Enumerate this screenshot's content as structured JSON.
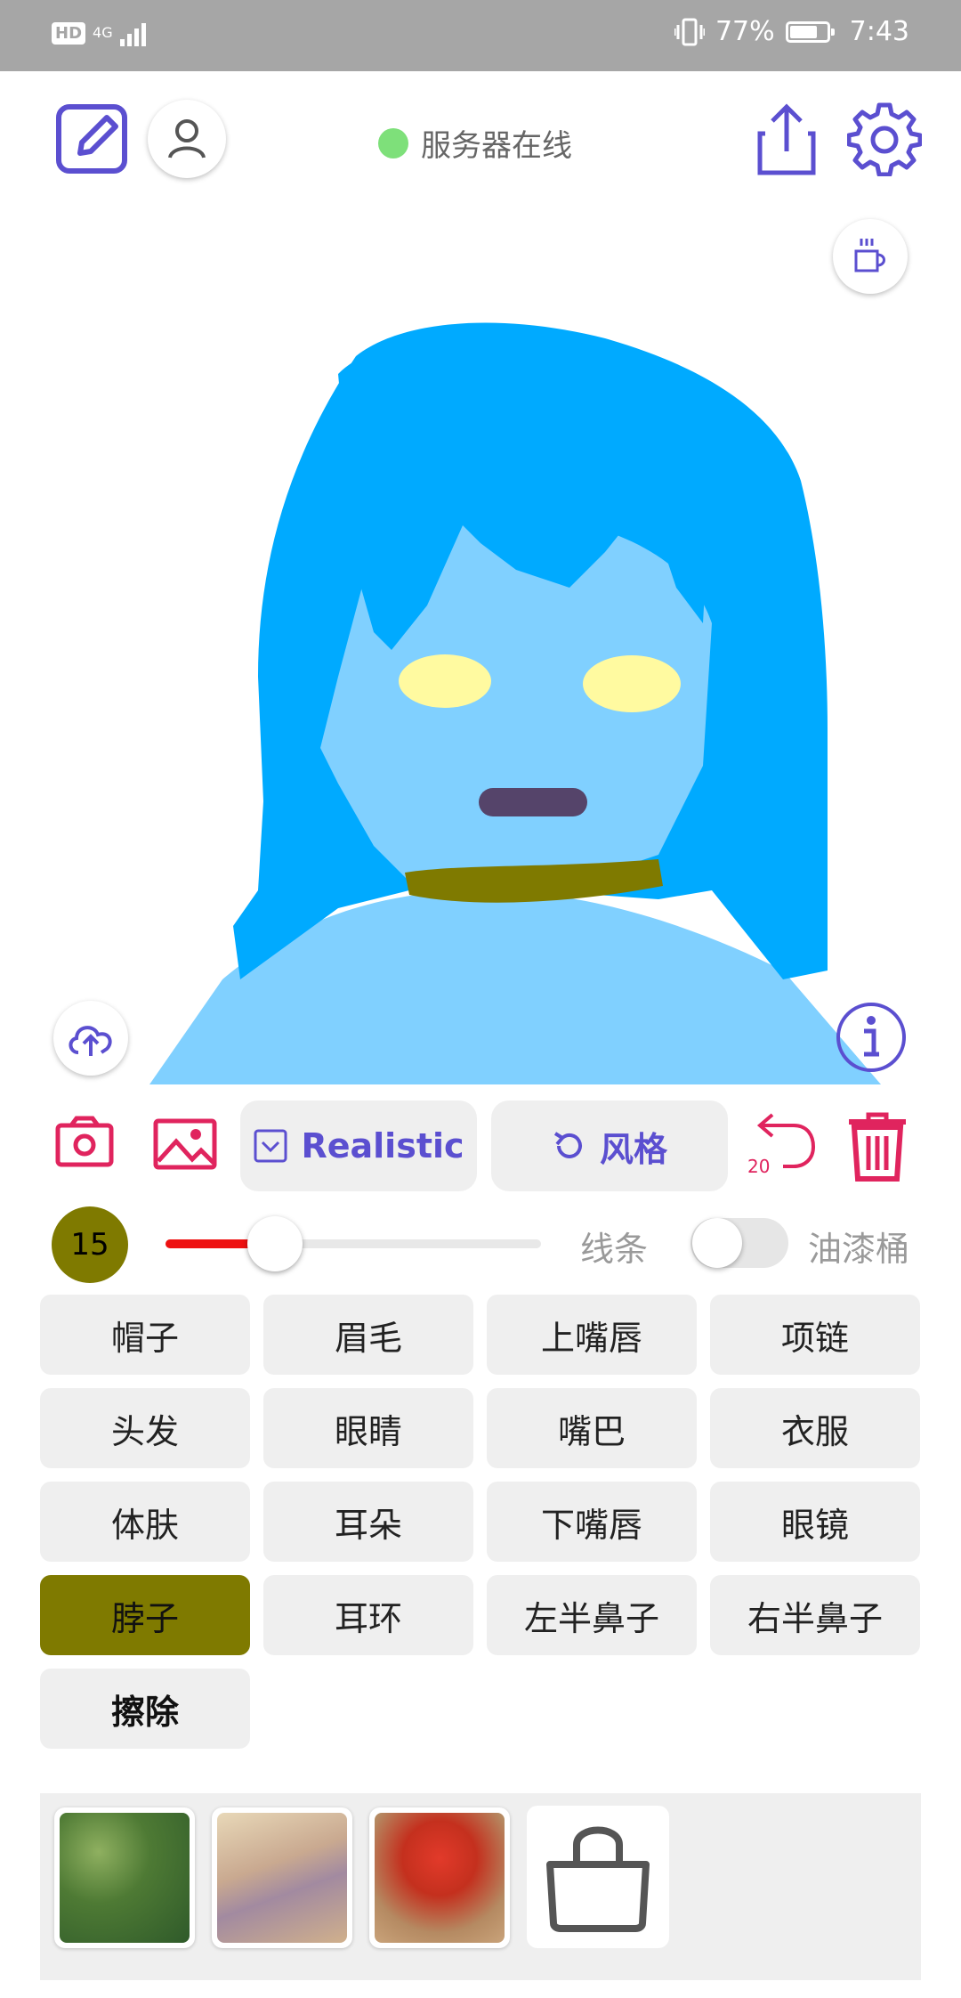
{
  "status_bar": {
    "left_badge": "HD",
    "signal_text": "4G",
    "battery_percent": "77%",
    "time": "7:43"
  },
  "header": {
    "server_status": "服务器在线"
  },
  "toolbar": {
    "model_label": "Realistic",
    "style_label": "风格",
    "undo_count": "20"
  },
  "brush": {
    "size": "15",
    "slider_value": 15,
    "mode_lines": "线条",
    "mode_bucket": "油漆桶"
  },
  "labels": [
    "帽子",
    "眉毛",
    "上嘴唇",
    "项链",
    "头发",
    "眼睛",
    "嘴巴",
    "衣服",
    "体肤",
    "耳朵",
    "下嘴唇",
    "眼镜",
    "脖子",
    "耳环",
    "左半鼻子",
    "右半鼻子",
    "擦除"
  ],
  "selected_label": "脖子",
  "colors": {
    "accent": "#5b4fd0",
    "danger": "#e0245e",
    "hair": "#00aaff",
    "skin": "#80d0ff",
    "eyes": "#fffaa0",
    "mouth": "#55446a",
    "neck": "#7f7a00",
    "online": "#7ee07a"
  }
}
